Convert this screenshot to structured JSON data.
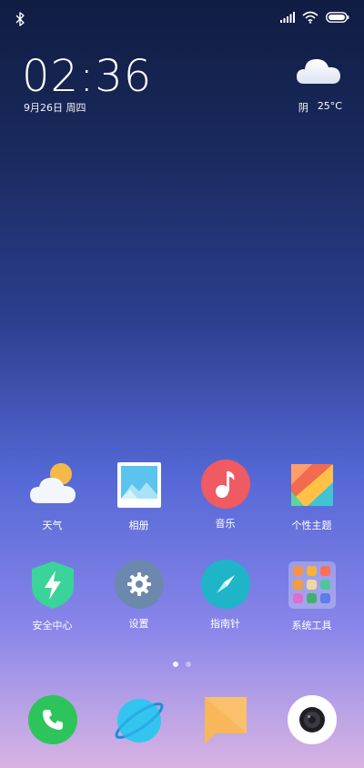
{
  "status": {
    "icons": [
      "bluetooth-icon",
      "cellular-signal-icon",
      "wifi-icon",
      "battery-icon"
    ]
  },
  "lockwidget": {
    "time": "02:36",
    "date": "9月26日 周四",
    "weather": {
      "condition": "阴",
      "temperature": "25°C",
      "icon": "cloud-icon"
    }
  },
  "apps_row1": [
    {
      "label": "天气",
      "icon": "weather-sun-cloud-icon"
    },
    {
      "label": "相册",
      "icon": "gallery-icon"
    },
    {
      "label": "音乐",
      "icon": "music-note-icon"
    },
    {
      "label": "个性主题",
      "icon": "themes-icon"
    }
  ],
  "apps_row2": [
    {
      "label": "安全中心",
      "icon": "shield-bolt-icon"
    },
    {
      "label": "设置",
      "icon": "gear-icon"
    },
    {
      "label": "指南针",
      "icon": "compass-icon"
    },
    {
      "label": "系统工具",
      "icon": "folder-icon"
    }
  ],
  "dock": [
    {
      "icon": "phone-icon"
    },
    {
      "icon": "browser-icon"
    },
    {
      "icon": "messages-icon"
    },
    {
      "icon": "camera-icon"
    }
  ],
  "pages": {
    "count": 2,
    "current": 1
  },
  "colors": {
    "weather_sun": "#f5b948",
    "gallery_sky": "#4bb0e6",
    "music": "#ef5a63",
    "security": "#3ad39a",
    "settings": "#6d88ad",
    "compass": "#1eb5c9",
    "phone": "#2dc45c",
    "browser": "#33c4f0",
    "messages": "#f7b75a"
  }
}
